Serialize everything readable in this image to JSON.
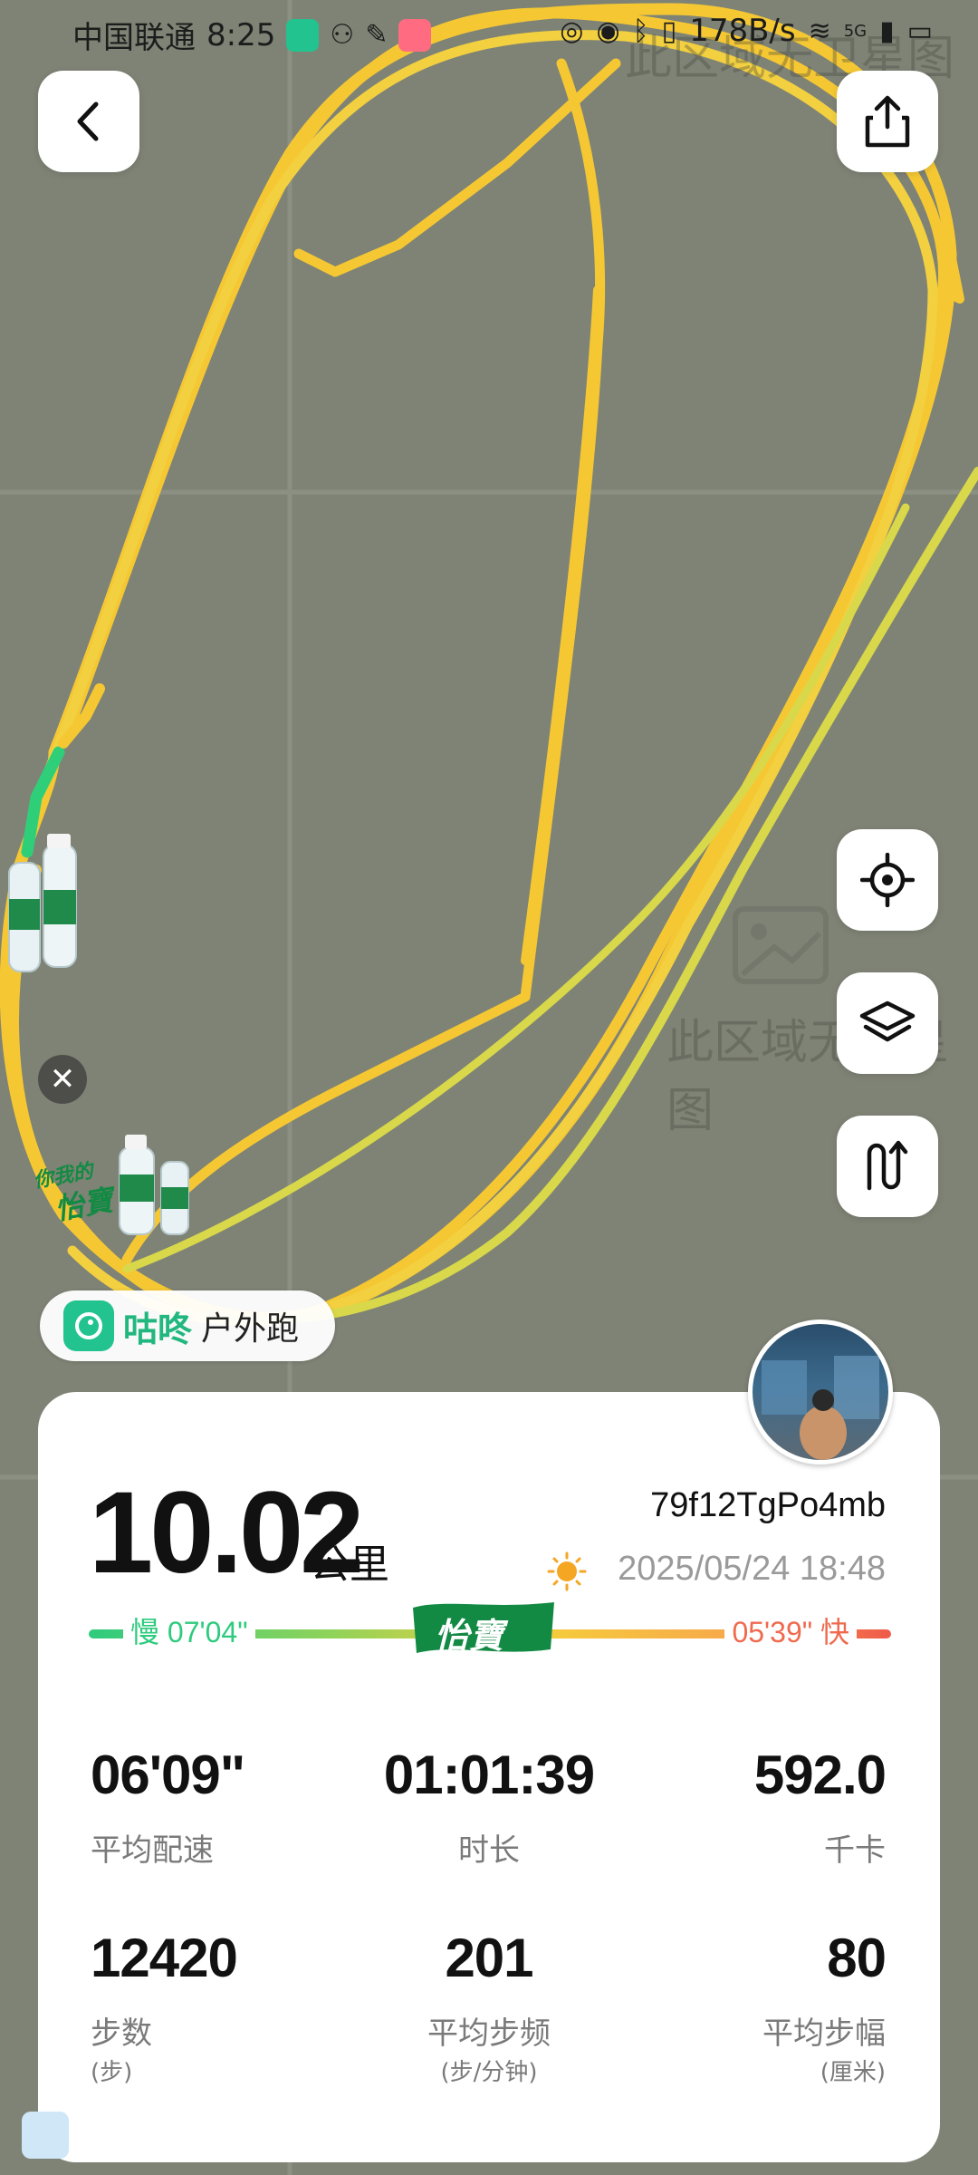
{
  "status_bar": {
    "carrier": "中国联通",
    "time": "8:25",
    "net_speed": "178B/s",
    "net_type": "5G"
  },
  "map": {
    "watermark_text": "此区域无卫星图",
    "brand_stamp_top": "你我的",
    "brand_stamp_bottom": "怡寶",
    "colors": {
      "route_main": "#f5c833",
      "route_alt": "#d9d84a",
      "route_start": "#2ecf78",
      "background": "#7f8375"
    }
  },
  "buttons": {
    "back_icon": "chevron-left-icon",
    "share_icon": "share-icon",
    "locate_icon": "locate-icon",
    "layers_icon": "layers-icon",
    "route_icon": "route-icon",
    "close_icon": "close-icon"
  },
  "app_badge": {
    "name": "咕咚",
    "activity": "户外跑"
  },
  "summary": {
    "distance": "10.02",
    "distance_unit": "公里",
    "user_id": "79f12TgPo4mb",
    "datetime": "2025/05/24 18:48"
  },
  "pace_legend": {
    "slow": "慢 07'04\"",
    "fast": "05'39\" 快",
    "brand": "怡寶"
  },
  "stats": [
    {
      "value": "06'09\"",
      "label": "平均配速",
      "sub": ""
    },
    {
      "value": "01:01:39",
      "label": "时长",
      "sub": ""
    },
    {
      "value": "592.0",
      "label": "千卡",
      "sub": ""
    },
    {
      "value": "12420",
      "label": "步数",
      "sub": "(步)"
    },
    {
      "value": "201",
      "label": "平均步频",
      "sub": "(步/分钟)"
    },
    {
      "value": "80",
      "label": "平均步幅",
      "sub": "(厘米)"
    }
  ]
}
